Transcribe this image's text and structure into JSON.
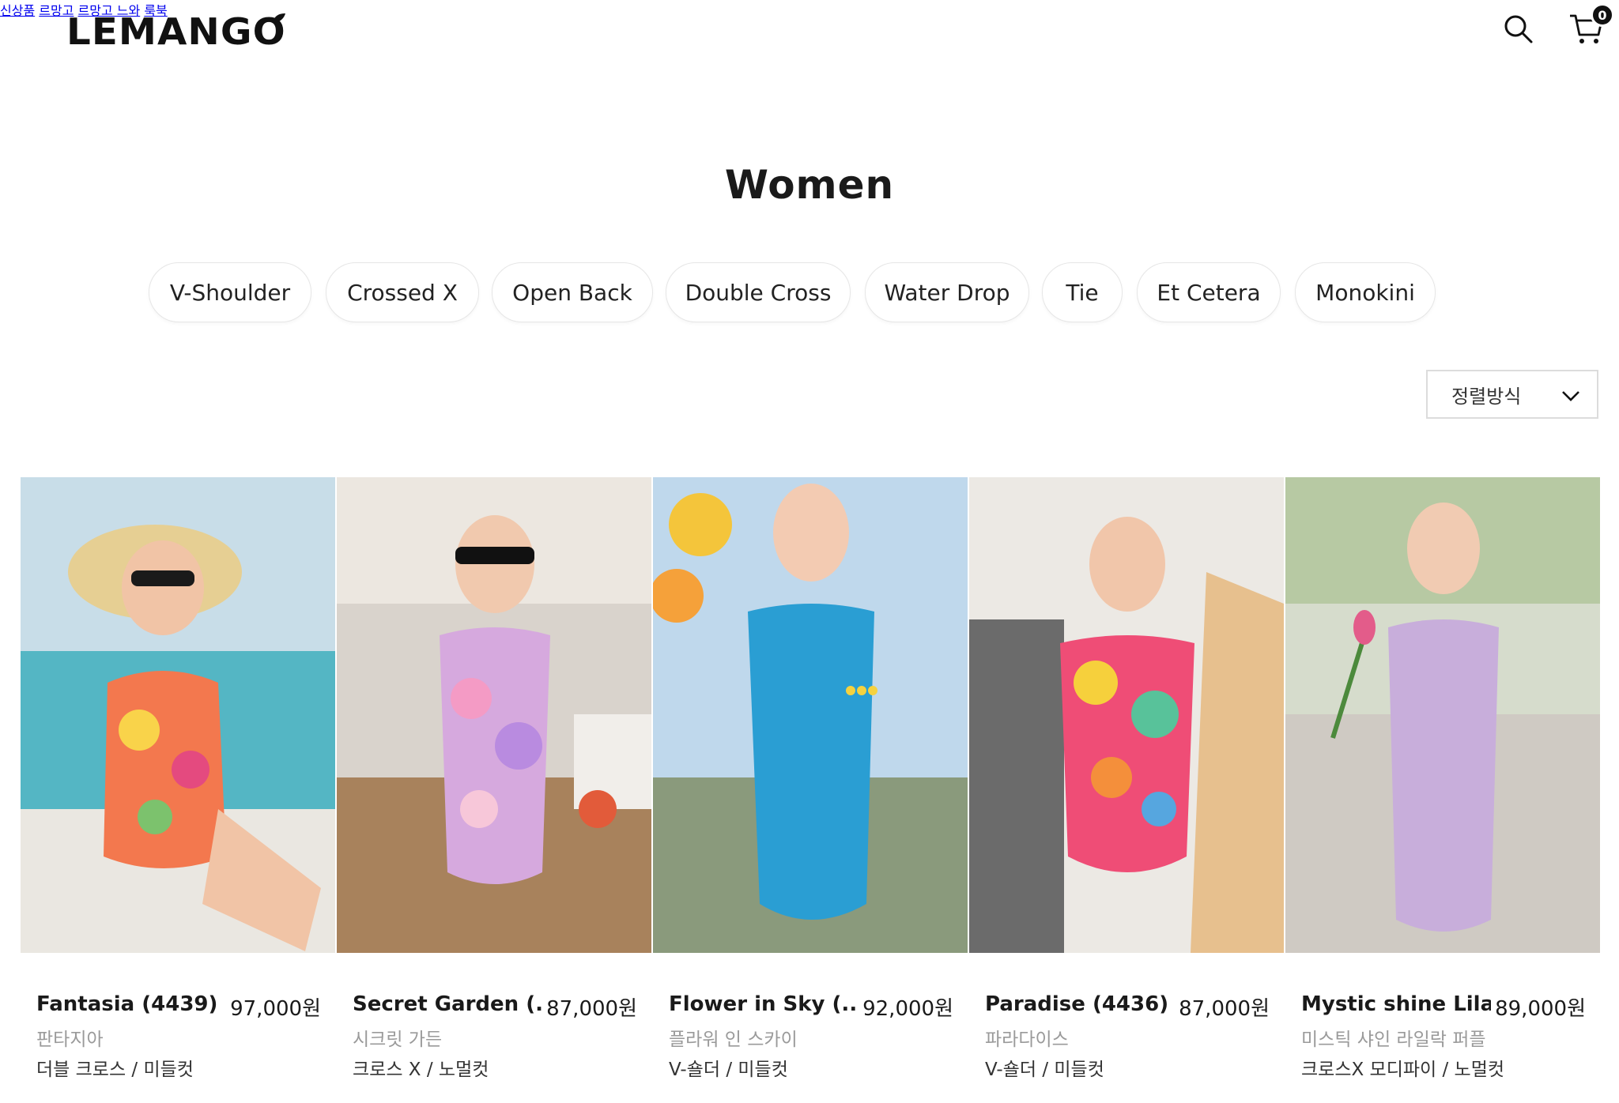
{
  "brand": {
    "logo_text": "LEMANGO"
  },
  "nav": [
    {
      "label": "신상품"
    },
    {
      "label": "르망고"
    },
    {
      "label": "르망고 느와"
    },
    {
      "label": "룩북"
    }
  ],
  "cart": {
    "count": "0"
  },
  "page": {
    "title": "Women"
  },
  "categories": [
    {
      "label": "V-Shoulder"
    },
    {
      "label": "Crossed X"
    },
    {
      "label": "Open Back"
    },
    {
      "label": "Double Cross"
    },
    {
      "label": "Water Drop"
    },
    {
      "label": "Tie"
    },
    {
      "label": "Et Cetera"
    },
    {
      "label": "Monokini"
    }
  ],
  "sort": {
    "label": "정렬방식"
  },
  "products": [
    {
      "name": "Fantasia (4439)",
      "price": "97,000원",
      "korean_name": "판타지아",
      "cut": "더블 크로스 / 미들컷"
    },
    {
      "name": "Secret Garden (...",
      "price": "87,000원",
      "korean_name": "시크릿 가든",
      "cut": "크로스 X / 노멀컷"
    },
    {
      "name": "Flower in Sky (...",
      "price": "92,000원",
      "korean_name": "플라워 인 스카이",
      "cut": "V-숄더 / 미들컷"
    },
    {
      "name": "Paradise (4436)",
      "price": "87,000원",
      "korean_name": "파라다이스",
      "cut": "V-숄더 / 미들컷"
    },
    {
      "name": "Mystic shine Lilac ...",
      "price": "89,000원",
      "korean_name": "미스틱 샤인 라일락 퍼플",
      "cut": "크로스X 모디파이 / 노멀컷"
    }
  ],
  "colors": {
    "text": "#1a1a1a",
    "muted": "#9a9a9a",
    "chip_border": "#e6e6e6"
  }
}
